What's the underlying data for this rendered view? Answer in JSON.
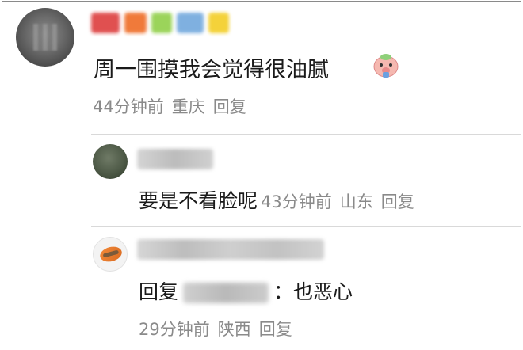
{
  "main_comment": {
    "text": "周一围摸我会觉得很油腻",
    "time": "44分钟前",
    "location": "重庆",
    "reply_label": "回复"
  },
  "replies": [
    {
      "text": "要是不看脸呢",
      "time": "43分钟前",
      "location": "山东",
      "reply_label": "回复"
    },
    {
      "prefix": "回复",
      "suffix": "：也恶心",
      "time": "29分钟前",
      "location": "陕西",
      "reply_label": "回复"
    }
  ],
  "colors": {
    "text": "#1a1a1a",
    "meta": "#8a8a8a",
    "divider": "#d9d9d9"
  },
  "icons": {
    "emoji": "piggy-emoji-icon"
  }
}
